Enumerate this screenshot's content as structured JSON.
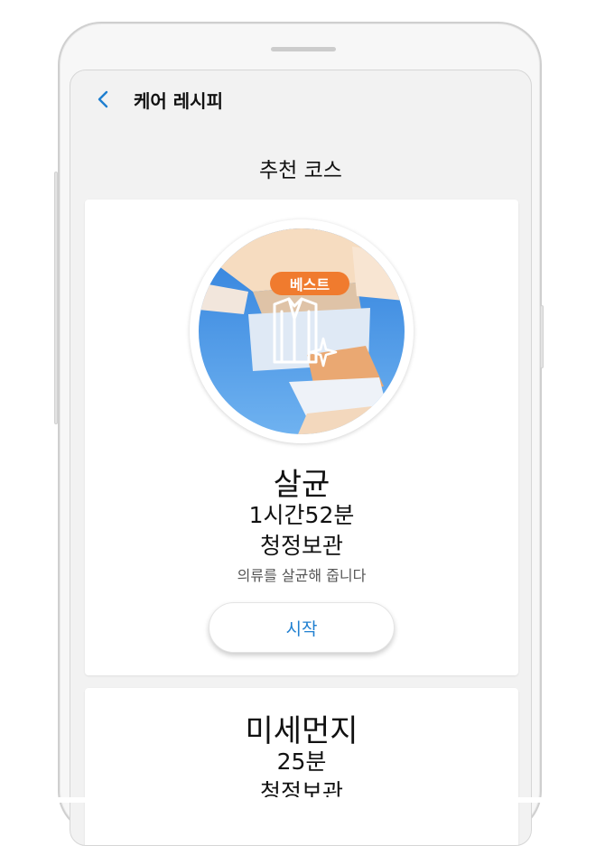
{
  "header": {
    "back_icon": "chevron-left-icon",
    "title": "케어 레시피"
  },
  "section_title": "추천 코스",
  "colors": {
    "accent": "#1f7fd0",
    "badge": "#f07b2e",
    "sky": "#3f8fe0"
  },
  "cards": [
    {
      "badge": "베스트",
      "icon": "shirt-sparkle-icon",
      "name": "살균",
      "time": "1시간52분",
      "category": "청정보관",
      "description": "의류를 살균해 줍니다",
      "start_label": "시작"
    },
    {
      "name": "미세먼지",
      "time": "25분",
      "category": "청정보관"
    }
  ]
}
